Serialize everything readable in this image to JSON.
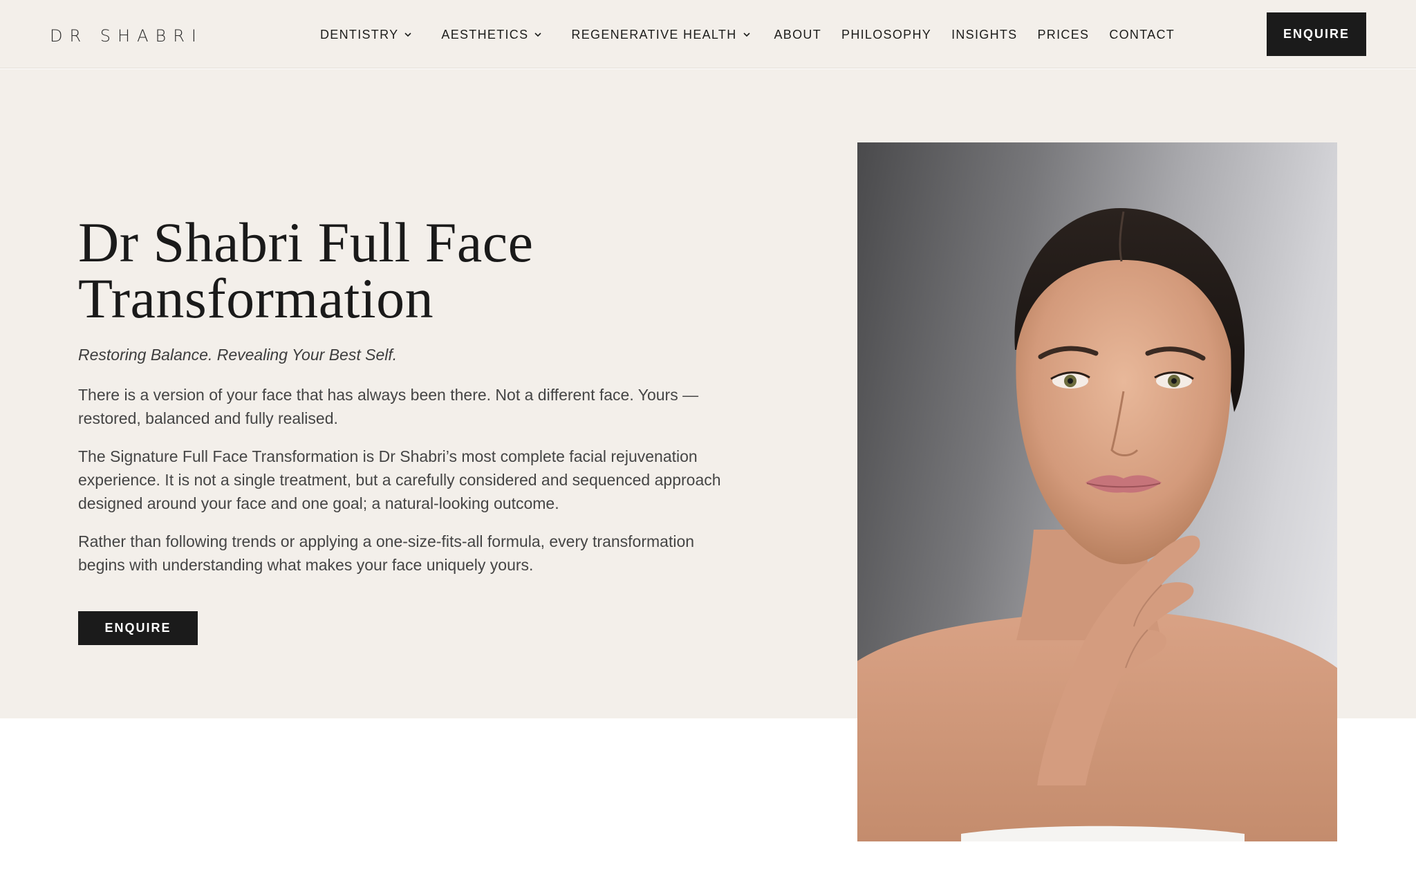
{
  "header": {
    "logo": "DR SHABRI",
    "nav": [
      {
        "label": "DENTISTRY",
        "has_dropdown": true
      },
      {
        "label": "AESTHETICS",
        "has_dropdown": true
      },
      {
        "label": "REGENERATIVE HEALTH",
        "has_dropdown": true
      },
      {
        "label": "ABOUT",
        "has_dropdown": false
      },
      {
        "label": "PHILOSOPHY",
        "has_dropdown": false
      },
      {
        "label": "INSIGHTS",
        "has_dropdown": false
      },
      {
        "label": "PRICES",
        "has_dropdown": false
      },
      {
        "label": "CONTACT",
        "has_dropdown": false
      }
    ],
    "cta_label": "ENQUIRE"
  },
  "hero": {
    "title": "Dr Shabri Full Face Transformation",
    "subtitle": "Restoring Balance. Revealing Your Best Self.",
    "paragraphs": [
      "There is a version of your face that has always been there. Not a different face. Yours — restored, balanced and fully realised.",
      "The Signature Full Face Transformation is Dr Shabri’s most complete facial rejuvenation experience. It is not a single treatment, but a carefully considered and sequenced approach designed around your face and one goal; a natural-looking outcome.",
      "Rather than following trends or applying a one-size-fits-all formula, every transformation begins with understanding what makes your face uniquely yours."
    ],
    "cta_label": "ENQUIRE"
  },
  "colors": {
    "background_cream": "#f3efea",
    "button_dark": "#1b1b1b",
    "text_dark": "#1d1d1b",
    "body_text": "#454545"
  }
}
